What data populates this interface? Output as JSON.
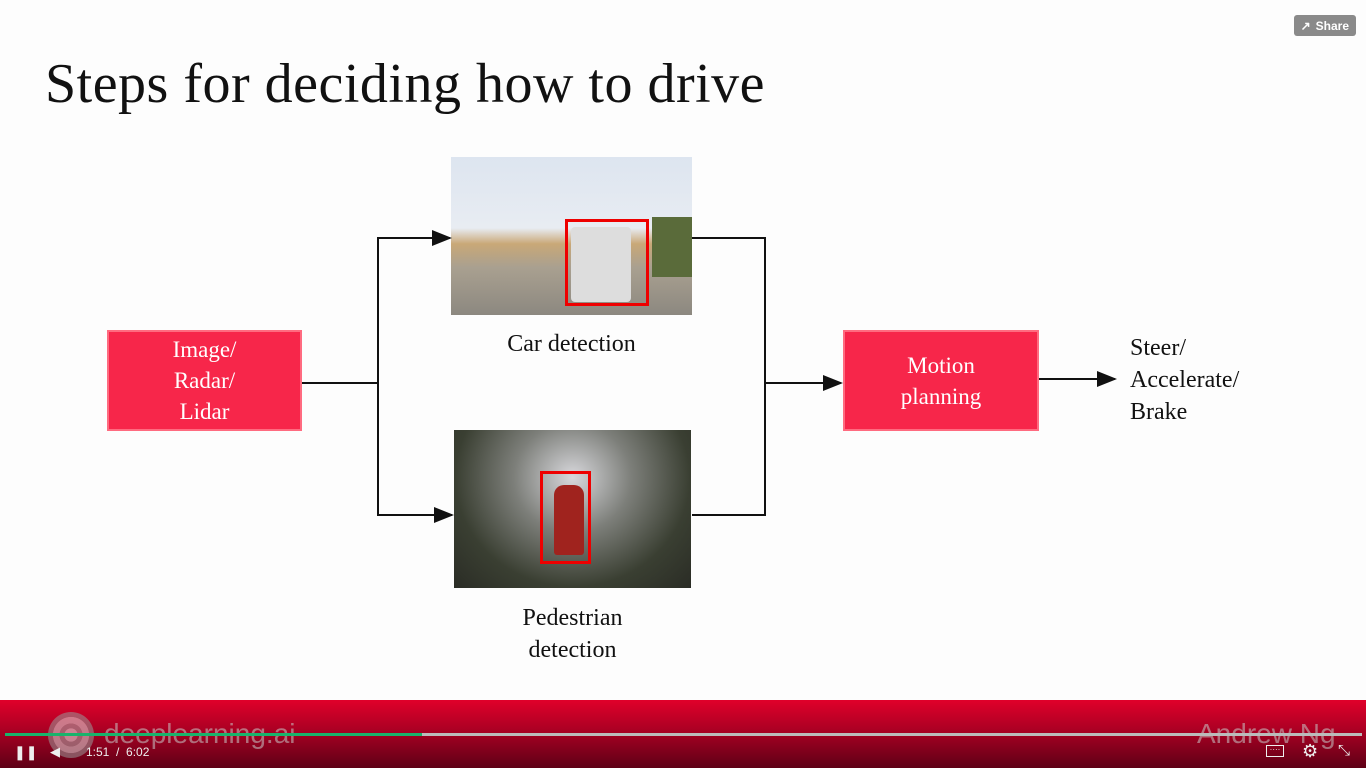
{
  "slide": {
    "title": "Steps for deciding how to drive",
    "input_box": [
      "Image/",
      "Radar/",
      "Lidar"
    ],
    "car_label": "Car detection",
    "pedestrian_label": [
      "Pedestrian",
      "detection"
    ],
    "motion_box": [
      "Motion",
      "planning"
    ],
    "output": [
      "Steer/",
      "Accelerate/",
      "Brake"
    ]
  },
  "share_label": "Share",
  "watermark": {
    "brand": "deeplearning.ai",
    "author": "Andrew Ng"
  },
  "player": {
    "current_time": "1:51",
    "separator": "/",
    "duration": "6:02",
    "progress": 0.307
  },
  "colors": {
    "box": "#f7264a",
    "progress": "#19b36b",
    "bar": "#b00024"
  }
}
